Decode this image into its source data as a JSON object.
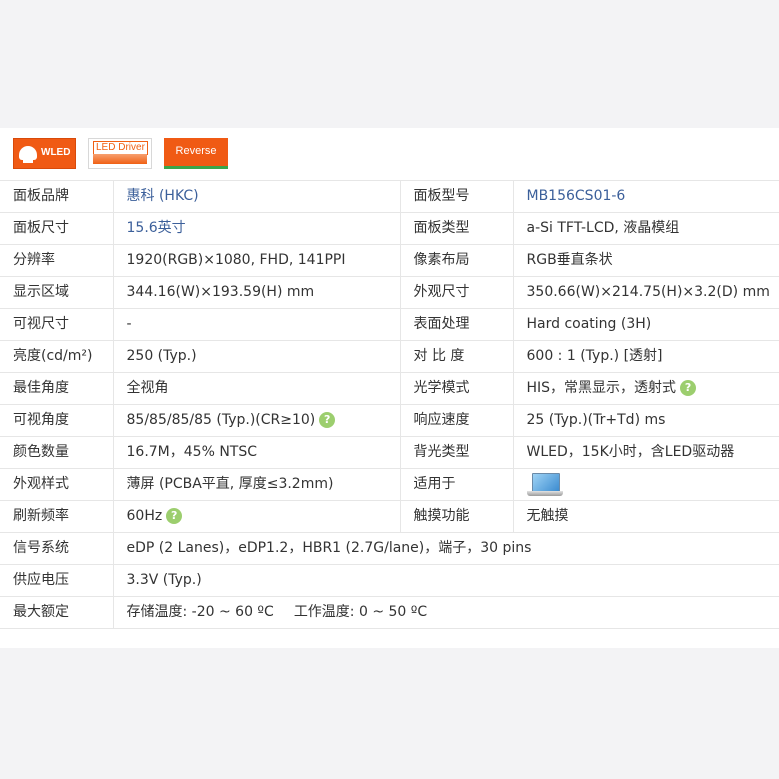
{
  "badges": {
    "wled": "WLED",
    "driver": "LED Driver",
    "reverse": "Reverse"
  },
  "rows": [
    {
      "l1": "面板品牌",
      "v1": "惠科 (HKC)",
      "l2": "面板型号",
      "v2": "MB156CS01-6"
    },
    {
      "l1": "面板尺寸",
      "v1": "15.6英寸",
      "l2": "面板类型",
      "v2": "a-Si TFT-LCD, 液晶模组"
    },
    {
      "l1": "分辨率",
      "v1": "1920(RGB)×1080, FHD, 141PPI",
      "l2": "像素布局",
      "v2": "RGB垂直条状"
    },
    {
      "l1": "显示区域",
      "v1": "344.16(W)×193.59(H) mm",
      "l2": "外观尺寸",
      "v2": "350.66(W)×214.75(H)×3.2(D) mm"
    },
    {
      "l1": "可视尺寸",
      "v1": "-",
      "l2": "表面处理",
      "v2": "Hard coating (3H)"
    },
    {
      "l1": "亮度(cd/m²)",
      "v1": "250 (Typ.)",
      "l2": "对 比 度",
      "v2": "600 : 1 (Typ.) [透射]"
    },
    {
      "l1": "最佳角度",
      "v1": "全视角",
      "l2": "光学模式",
      "v2": "HIS，常黑显示，透射式"
    },
    {
      "l1": "可视角度",
      "v1": "85/85/85/85 (Typ.)(CR≥10)",
      "l2": "响应速度",
      "v2": "25 (Typ.)(Tr+Td) ms"
    },
    {
      "l1": "颜色数量",
      "v1": "16.7M，45% NTSC",
      "l2": "背光类型",
      "v2": "WLED，15K小时，含LED驱动器"
    },
    {
      "l1": "外观样式",
      "v1": "薄屏 (PCBA平直, 厚度≤3.2mm)",
      "l2": "适用于",
      "v2": ""
    },
    {
      "l1": "刷新频率",
      "v1": "60Hz",
      "l2": "触摸功能",
      "v2": "无触摸"
    }
  ],
  "wide_rows": [
    {
      "l": "信号系统",
      "v": "eDP (2 Lanes)，eDP1.2，HBR1 (2.7G/lane)，端子，30 pins"
    },
    {
      "l": "供应电压",
      "v": "3.3V (Typ.)"
    }
  ],
  "rating": {
    "label": "最大额定",
    "storage": "存储温度: -20 ~ 60 ºC",
    "operating": "工作温度: 0 ~ 50 ºC"
  },
  "help_glyph": "?",
  "icons": {
    "help": "question-circle-icon",
    "laptop": "laptop-icon",
    "bulb": "bulb-icon"
  }
}
